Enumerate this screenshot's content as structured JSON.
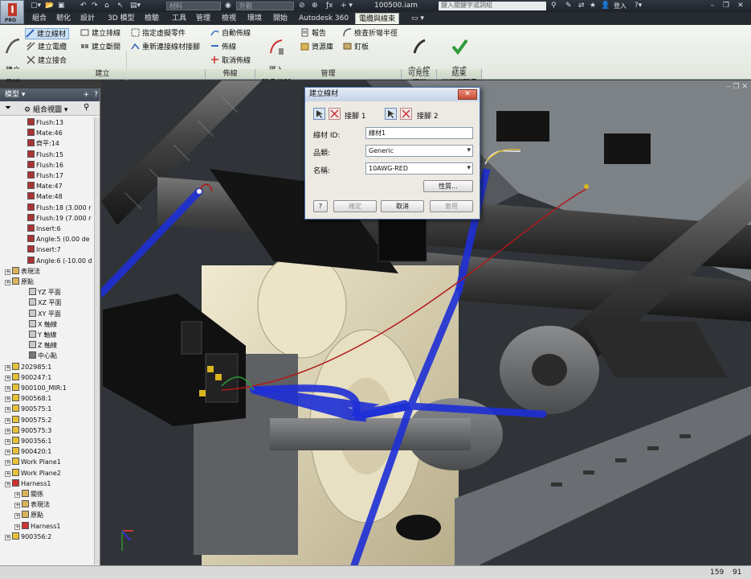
{
  "qat": {
    "material_placeholder": "材料",
    "appearance_placeholder": "外觀",
    "doc_title": "100500.iam",
    "search_placeholder": "鍵入關鍵字或詞組",
    "login": "登入"
  },
  "tabs": [
    "組合",
    "韌化",
    "設計",
    "3D 模型",
    "檢驗",
    "工具",
    "管理",
    "檢視",
    "環境",
    "開始",
    "Autodesk 360",
    "電纜與線束"
  ],
  "ribbon": {
    "create_segment": "建立\n管段",
    "create_wire": "建立線材",
    "create_cable": "建立電纜",
    "create_splice": "建立接合",
    "create_ribbon_cable": "建立排線",
    "create_harness_disconnect": "建立斷開",
    "assign_virtual_part": "指定虛擬零件",
    "reconnect_wire": "重新連接線材接腳",
    "auto_route": "自動佈線",
    "route": "佈線",
    "unroute": "取消佈線",
    "import_harness_data": "匯入\n線束資料",
    "report": "報告",
    "library": "資源庫",
    "check_bend_radius": "檢查折彎半徑",
    "nailboard": "釘板",
    "centerline_display": "中心線\n顯示",
    "finish": "完成\n電纜與線束",
    "panels": {
      "create": "建立",
      "route": "佈線",
      "manage": "管理",
      "visibility": "可見性",
      "exit": "結束"
    }
  },
  "browser": {
    "title": "模型",
    "view": "組合視圖",
    "nodes": [
      {
        "label": "Flush:13",
        "type": "constraint"
      },
      {
        "label": "Mate:46",
        "type": "constraint"
      },
      {
        "label": "齊平:14",
        "type": "constraint"
      },
      {
        "label": "Flush:15",
        "type": "constraint"
      },
      {
        "label": "Flush:16",
        "type": "constraint"
      },
      {
        "label": "Flush:17",
        "type": "constraint"
      },
      {
        "label": "Mate:47",
        "type": "constraint"
      },
      {
        "label": "Mate:48",
        "type": "constraint"
      },
      {
        "label": "Flush:18 (3.000 r",
        "type": "constraint"
      },
      {
        "label": "Flush:19 (7.000 r",
        "type": "constraint"
      },
      {
        "label": "Insert:6",
        "type": "constraint"
      },
      {
        "label": "Angle:5 (0.00 de",
        "type": "angle"
      },
      {
        "label": "Insert:7",
        "type": "constraint"
      },
      {
        "label": "Angle:6 (-10.00 d",
        "type": "angle"
      },
      {
        "label": "表現法",
        "type": "folder"
      },
      {
        "label": "原點",
        "type": "folder"
      },
      {
        "label": "YZ 平面",
        "type": "plane"
      },
      {
        "label": "XZ 平面",
        "type": "plane"
      },
      {
        "label": "XY 平面",
        "type": "plane"
      },
      {
        "label": "X 軸線",
        "type": "plane"
      },
      {
        "label": "Y 軸線",
        "type": "plane"
      },
      {
        "label": "Z 軸線",
        "type": "plane"
      },
      {
        "label": "中心點",
        "type": "point"
      },
      {
        "label": "202985:1",
        "type": "part"
      },
      {
        "label": "900247:1",
        "type": "part"
      },
      {
        "label": "900100_MIR:1",
        "type": "part"
      },
      {
        "label": "900568:1",
        "type": "part"
      },
      {
        "label": "900575:1",
        "type": "part"
      },
      {
        "label": "900575:2",
        "type": "part"
      },
      {
        "label": "900575:3",
        "type": "part"
      },
      {
        "label": "900356:1",
        "type": "part"
      },
      {
        "label": "900420:1",
        "type": "part"
      },
      {
        "label": "Work Plane1",
        "type": "part"
      },
      {
        "label": "Work Plane2",
        "type": "part"
      },
      {
        "label": "Harness1",
        "type": "harness"
      },
      {
        "label": "關係",
        "type": "folder"
      },
      {
        "label": "表現法",
        "type": "folder"
      },
      {
        "label": "原點",
        "type": "folder"
      },
      {
        "label": "Harness1",
        "type": "harness"
      },
      {
        "label": "900356:2",
        "type": "part"
      }
    ]
  },
  "dialog": {
    "title": "建立線材",
    "pin1": "接腳 1",
    "pin2": "接腳 2",
    "wire_id_label": "線材 ID:",
    "wire_id_value": "線材1",
    "category_label": "品類:",
    "category_value": "Generic",
    "name_label": "名稱:",
    "name_value": "10AWG-RED",
    "properties_btn": "性質...",
    "ok_btn": "確定",
    "cancel_btn": "取消",
    "apply_btn": "套用"
  },
  "status": {
    "x": "159",
    "y": "91"
  },
  "colors": {
    "harness_blue": "#1e2fd6",
    "wire_red": "#b01818",
    "ribbon_bg": "#eef2e8"
  }
}
